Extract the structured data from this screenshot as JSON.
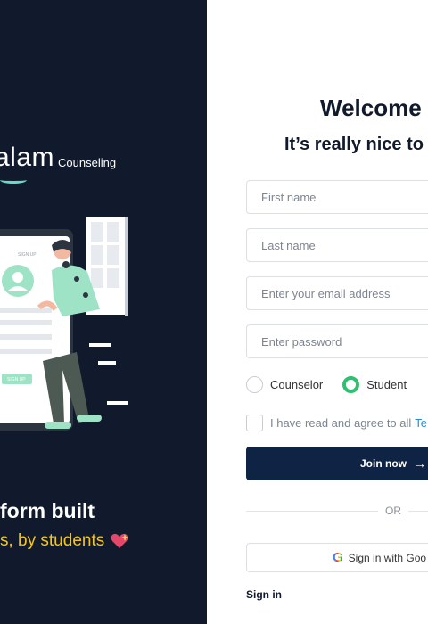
{
  "brand": {
    "logo_text": "alam",
    "logo_subtext": "Counseling",
    "accent": "#6fd6c4"
  },
  "illustration": {
    "phone_header": "SIGN UP",
    "phone_button": "SIGN UP"
  },
  "tagline": {
    "line1": "form built",
    "line2": "s, by students",
    "heart_icon": "sparkling-heart"
  },
  "form": {
    "title": "Welcome",
    "subtitle": "It’s really nice to",
    "first_name_placeholder": "First name",
    "last_name_placeholder": "Last name",
    "email_placeholder": "Enter your email address",
    "password_placeholder": "Enter password",
    "role_counselor": "Counselor",
    "role_student": "Student",
    "role_selected": "Student",
    "agree_text": "I have read and agree to all",
    "terms_link": "Te",
    "join_button": "Join now",
    "or_label": "OR",
    "google_button": "Sign in with Goo",
    "signin_link": "Sign in"
  },
  "colors": {
    "left_bg": "#111a2c",
    "primary_button": "#0f2444",
    "tagline_yellow": "#f5c51d",
    "radio_green": "#2fbf71",
    "link_blue": "#2a8bd8"
  }
}
